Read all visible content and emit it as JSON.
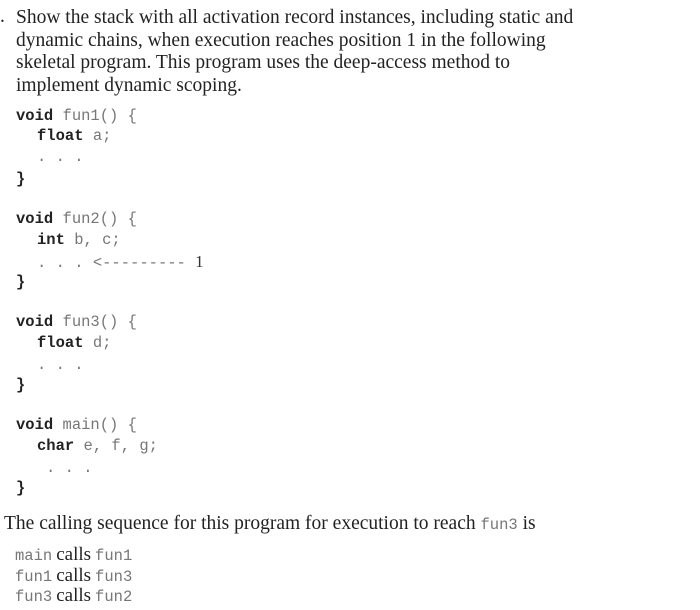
{
  "question": {
    "marker": ".",
    "lines": [
      "Show the stack with all activation record instances, including static and",
      "dynamic chains, when execution reaches position 1 in the following",
      "skeletal program. This program uses the deep-access method to",
      "implement dynamic scoping."
    ]
  },
  "program": {
    "functions": [
      {
        "keyword": "void",
        "signature": "fun1() {",
        "decl_type": "float",
        "decl_vars": "a;",
        "body": ". . .",
        "close": "}"
      },
      {
        "keyword": "void",
        "signature": "fun2() {",
        "decl_type": "int",
        "decl_vars": "b, c;",
        "body": ". . .",
        "marker_arrow": "<---------",
        "marker_label": "1",
        "close": "}"
      },
      {
        "keyword": "void",
        "signature": "fun3() {",
        "decl_type": "float",
        "decl_vars": "d;",
        "body": ". . .",
        "close": "}"
      },
      {
        "keyword": "void",
        "signature": "main() {",
        "decl_type": "char",
        "decl_vars": "e, f, g;",
        "body": ". . .",
        "close": "}"
      }
    ]
  },
  "calling_sequence": {
    "intro_text": "The calling sequence for this program for execution to reach ",
    "intro_code": "fun3",
    "intro_suffix": " is",
    "calls": [
      {
        "caller": "main",
        "verb": "calls",
        "callee": "fun1"
      },
      {
        "caller": "fun1",
        "verb": "calls",
        "callee": "fun3"
      },
      {
        "caller": "fun3",
        "verb": "calls",
        "callee": "fun2"
      }
    ]
  }
}
